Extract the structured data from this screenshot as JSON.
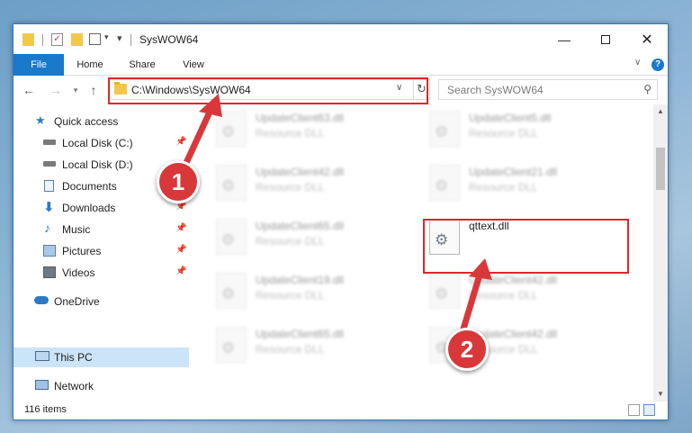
{
  "window": {
    "title": "SysWOW64",
    "minimize_icon": "minimize-icon",
    "maximize_icon": "maximize-icon",
    "close_icon": "close-icon"
  },
  "ribbon": {
    "tabs": [
      {
        "label": "File"
      },
      {
        "label": "Home"
      },
      {
        "label": "Share"
      },
      {
        "label": "View"
      }
    ],
    "expand_icon": "chevron-down-icon",
    "help_icon": "help-icon"
  },
  "address": {
    "path": "C:\\Windows\\SysWOW64",
    "search_placeholder": "Search SysWOW64"
  },
  "nav": {
    "items": [
      {
        "label": "Quick access",
        "icon": "star-icon"
      },
      {
        "label": "Local Disk (C:)",
        "icon": "drive-icon",
        "pinned": true
      },
      {
        "label": "Local Disk (D:)",
        "icon": "drive-icon"
      },
      {
        "label": "Documents",
        "icon": "document-icon",
        "pinned": true
      },
      {
        "label": "Downloads",
        "icon": "download-icon",
        "pinned": true
      },
      {
        "label": "Music",
        "icon": "music-icon",
        "pinned": true
      },
      {
        "label": "Pictures",
        "icon": "picture-icon",
        "pinned": true
      },
      {
        "label": "Videos",
        "icon": "video-icon",
        "pinned": true
      },
      {
        "label": "OneDrive",
        "icon": "cloud-icon"
      },
      {
        "label": "This PC",
        "icon": "computer-icon",
        "selected": true
      },
      {
        "label": "Network",
        "icon": "network-icon"
      }
    ]
  },
  "files": {
    "left": [
      {
        "name": "UpdateClient63.dll",
        "type": "Resource DLL"
      },
      {
        "name": "UpdateClient42.dll",
        "type": "Resource DLL"
      },
      {
        "name": "UpdateClient65.dll",
        "type": "Resource DLL"
      },
      {
        "name": "UpdateClient19.dll",
        "type": "Resource DLL"
      },
      {
        "name": "UpdateClient65.dll",
        "type": "Resource DLL"
      }
    ],
    "right": [
      {
        "name": "UpdateClient5.dll",
        "type": "Resource DLL"
      },
      {
        "name": "UpdateClient21.dll",
        "type": "Resource DLL"
      },
      {
        "name": "qttext.dll",
        "type": ""
      },
      {
        "name": "UpdateClient42.dll",
        "type": "Resource DLL"
      },
      {
        "name": "UpdateClient42.dll",
        "type": "Resource DLL"
      }
    ]
  },
  "status": {
    "item_count": "116 items"
  },
  "annotations": {
    "marker1": "1",
    "marker2": "2",
    "color": "#d9383a"
  }
}
